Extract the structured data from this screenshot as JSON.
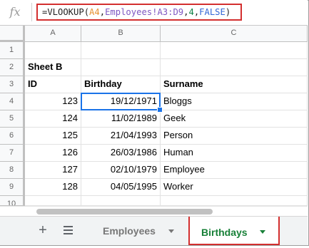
{
  "formula_bar": {
    "fx_label": "fx",
    "parts": [
      "=VLOOKUP(",
      "A4",
      ",",
      "Employees!A3:D9",
      ",",
      "4",
      ",",
      "FALSE",
      ")"
    ]
  },
  "grid": {
    "columns": [
      "A",
      "B",
      "C"
    ],
    "rows": [
      "1",
      "2",
      "3",
      "4",
      "5",
      "6",
      "7",
      "8",
      "9",
      "10"
    ],
    "cells": {
      "r2": {
        "a": "Sheet B",
        "b": "",
        "c": ""
      },
      "r3": {
        "a": "ID",
        "b": "Birthday",
        "c": "Surname"
      },
      "r4": {
        "a": "123",
        "b": "19/12/1971",
        "c": "Bloggs"
      },
      "r5": {
        "a": "124",
        "b": "11/02/1989",
        "c": "Geek"
      },
      "r6": {
        "a": "125",
        "b": "21/04/1993",
        "c": "Person"
      },
      "r7": {
        "a": "126",
        "b": "26/03/1986",
        "c": "Human"
      },
      "r8": {
        "a": "127",
        "b": "02/10/1979",
        "c": "Employee"
      },
      "r9": {
        "a": "128",
        "b": "04/05/1995",
        "c": "Worker"
      }
    },
    "selected_cell": "B4"
  },
  "sheet_tabs": {
    "add_icon": "plus-icon",
    "list_icon": "menu-list-icon",
    "tabs": [
      {
        "label": "Employees",
        "active": false
      },
      {
        "label": "Birthdays",
        "active": true
      }
    ]
  },
  "colors": {
    "highlight": "#d32f2f",
    "selection": "#1a73e8",
    "active_tab": "#188038"
  }
}
